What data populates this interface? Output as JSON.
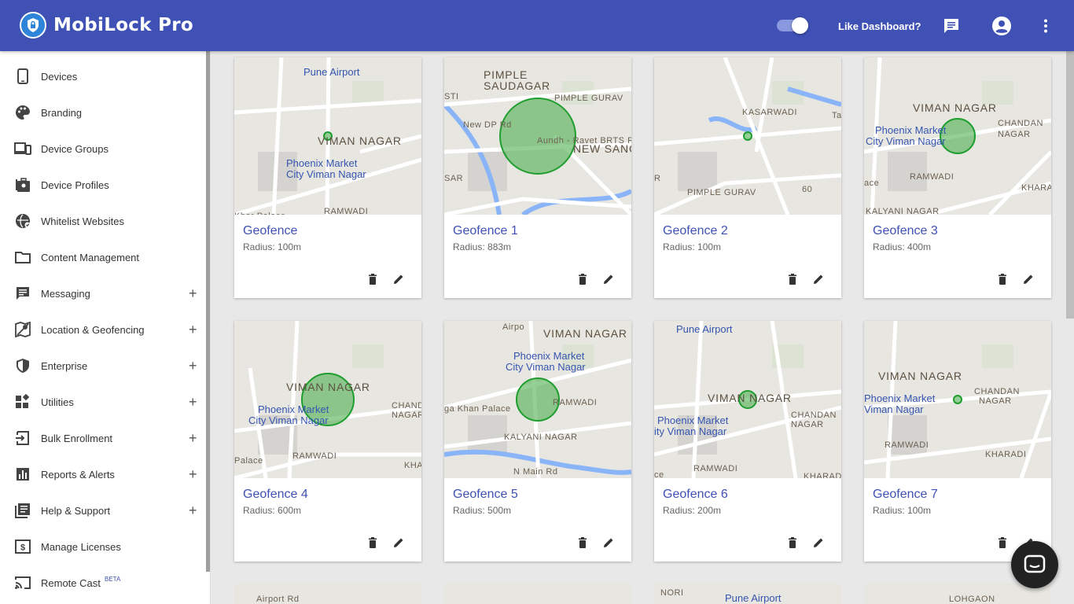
{
  "app": {
    "title": "MobiLock Pro"
  },
  "header": {
    "like_dashboard": "Like Dashboard?"
  },
  "sidebar": {
    "items": [
      {
        "label": "Devices",
        "icon": "phone-icon",
        "expandable": false
      },
      {
        "label": "Branding",
        "icon": "palette-icon",
        "expandable": false
      },
      {
        "label": "Device Groups",
        "icon": "devices-icon",
        "expandable": false
      },
      {
        "label": "Device Profiles",
        "icon": "profiles-icon",
        "expandable": false
      },
      {
        "label": "Whitelist Websites",
        "icon": "globe-icon",
        "expandable": false
      },
      {
        "label": "Content Management",
        "icon": "folder-icon",
        "expandable": false
      },
      {
        "label": "Messaging",
        "icon": "message-icon",
        "expandable": true
      },
      {
        "label": "Location & Geofencing",
        "icon": "map-icon",
        "expandable": true
      },
      {
        "label": "Enterprise",
        "icon": "shield-icon",
        "expandable": true
      },
      {
        "label": "Utilities",
        "icon": "widgets-icon",
        "expandable": true
      },
      {
        "label": "Bulk Enrollment",
        "icon": "login-icon",
        "expandable": true
      },
      {
        "label": "Reports & Alerts",
        "icon": "chart-icon",
        "expandable": true
      },
      {
        "label": "Help & Support",
        "icon": "help-doc-icon",
        "expandable": true
      },
      {
        "label": "Manage Licenses",
        "icon": "license-icon",
        "expandable": false
      },
      {
        "label": "Remote Cast",
        "icon": "cast-icon",
        "expandable": false,
        "badge": "BETA"
      }
    ],
    "plus": "+"
  },
  "geofences": [
    {
      "name": "Geofence",
      "radius": "Radius: 100m",
      "labels": [
        "Pune Airport",
        "VIMAN NAGAR",
        "Phoenix Market",
        "City Viman Nagar",
        "RAMWADI",
        "Khar Palace"
      ]
    },
    {
      "name": "Geofence 1",
      "radius": "Radius: 883m",
      "labels": [
        "PIMPLE",
        "SAUDAGAR",
        "PIMPLE GURAV",
        "NEW SANG",
        "STI",
        "SAR",
        "New DP Rd",
        "Aundh - Ravet BRTS Rd"
      ]
    },
    {
      "name": "Geofence 2",
      "radius": "Radius: 100m",
      "labels": [
        "KASARWADI",
        "PIMPLE GURAV",
        "Ta",
        "60",
        "R"
      ]
    },
    {
      "name": "Geofence 3",
      "radius": "Radius: 400m",
      "labels": [
        "VIMAN NAGAR",
        "Phoenix Market",
        "City Viman Nagar",
        "CHANDAN",
        "NAGAR",
        "RAMWADI",
        "KHARAI",
        "KALYANI NAGAR",
        "ace"
      ]
    },
    {
      "name": "Geofence 4",
      "radius": "Radius: 600m",
      "labels": [
        "VIMAN NAGAR",
        "Phoenix Market",
        "City Viman Nagar",
        "CHAND",
        "NAGAR",
        "RAMWADI",
        "Palace",
        "KHA"
      ]
    },
    {
      "name": "Geofence 5",
      "radius": "Radius: 500m",
      "labels": [
        "VIMAN NAGAR",
        "Phoenix Market",
        "City Viman Nagar",
        "ga Khan Palace",
        "RAMWADI",
        "KALYANI NAGAR",
        "N Main Rd",
        "Airpo"
      ]
    },
    {
      "name": "Geofence 6",
      "radius": "Radius: 200m",
      "labels": [
        "Pune Airport",
        "VIMAN NAGAR",
        "Phoenix Market",
        "ity Viman Nagar",
        "CHANDAN",
        "NAGAR",
        "RAMWADI",
        "KHARADI",
        "ce"
      ]
    },
    {
      "name": "Geofence 7",
      "radius": "Radius: 100m",
      "labels": [
        "VIMAN NAGAR",
        "Phoenix Market",
        "Viman Nagar",
        "CHANDAN",
        "NAGAR",
        "RAMWADI",
        "KHARADI"
      ]
    }
  ],
  "partial_row": [
    "Airport Rd",
    "NORI",
    "Pune Airport",
    "LOHGAON"
  ],
  "colors": {
    "primary": "#3f51b5",
    "geofence_fill": "#4caf50"
  }
}
